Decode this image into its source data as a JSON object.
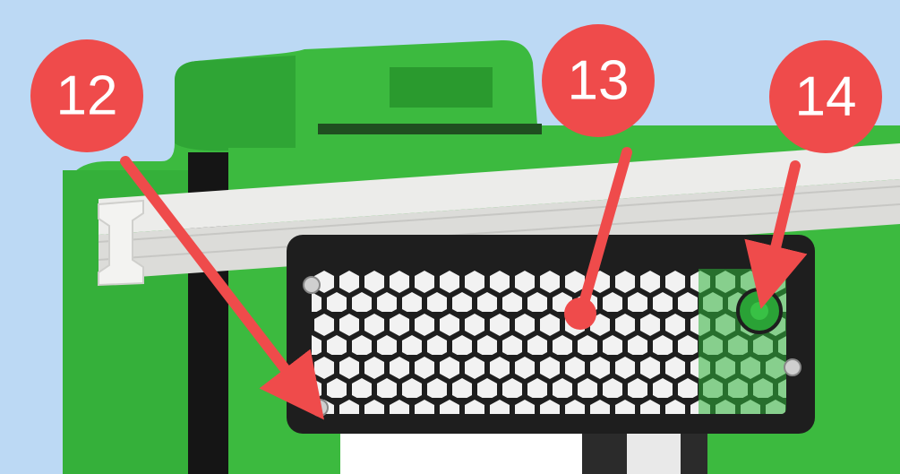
{
  "scene": {
    "background_color": "#bcd9f4",
    "body_color": "#3cba3f",
    "body_shadow_color": "#2a9a2e",
    "rail_color": "#e6e6e4",
    "grille_color": "#1e1e1e",
    "screw_color": "#c9c9c9"
  },
  "callouts": [
    {
      "id": "callout-12",
      "label": "12",
      "color": "#ef4b4b"
    },
    {
      "id": "callout-13",
      "label": "13",
      "color": "#ef4b4b"
    },
    {
      "id": "callout-14",
      "label": "14",
      "color": "#ef4b4b"
    }
  ]
}
